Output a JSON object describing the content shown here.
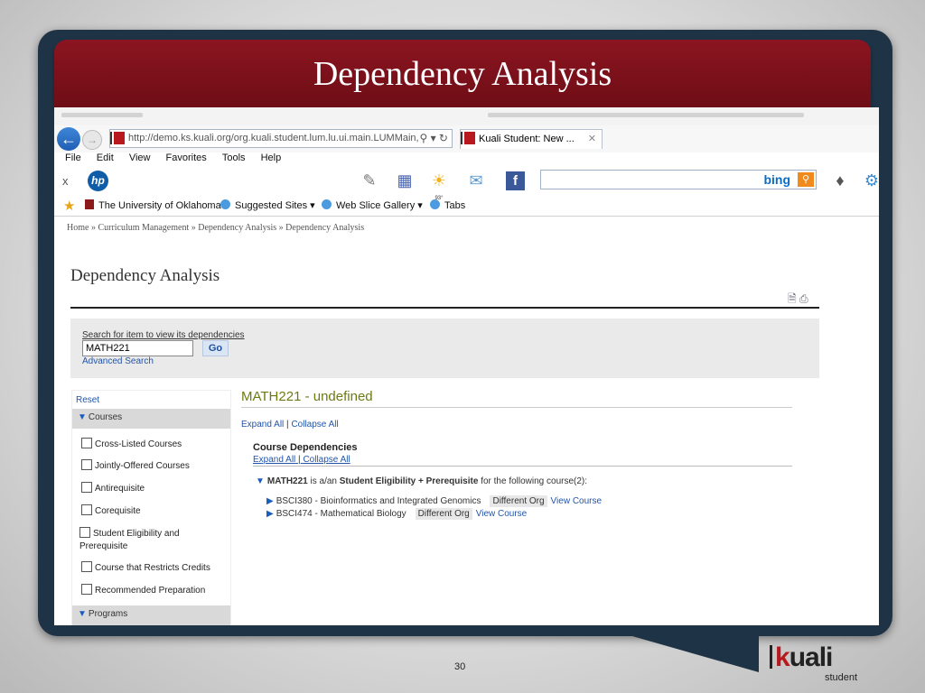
{
  "slide": {
    "title": "Dependency Analysis",
    "page_number": "30",
    "logo": {
      "mark": "kuali",
      "sub": "student"
    }
  },
  "browser": {
    "url": "http://demo.ks.kuali.org/org.kuali.student.lum.lu.ui.main.LUMMain,",
    "tab_title": "Kuali Student: New ...",
    "menu": [
      "File",
      "Edit",
      "View",
      "Favorites",
      "Tools",
      "Help"
    ],
    "search_engine": "bing",
    "favorites": [
      "The University of Oklahoma",
      "Suggested Sites ▾",
      "Web Slice Gallery ▾",
      "Tabs"
    ],
    "toolbar_icons": [
      "hp-icon",
      "news-icon",
      "traffic-icon",
      "weather-icon",
      "mail-icon",
      "facebook-icon",
      "games-icon"
    ],
    "weather_temp": "93°"
  },
  "page": {
    "breadcrumb": "Home » Curriculum Management » Dependency Analysis » Dependency Analysis",
    "title": "Dependency Analysis",
    "search": {
      "label": "Search for item to view its dependencies",
      "value": "MATH221",
      "go": "Go",
      "advanced": "Advanced Search"
    },
    "facets": {
      "reset": "Reset",
      "courses_header": "Courses",
      "items": [
        "Cross-Listed Courses",
        "Jointly-Offered Courses",
        "Antirequisite",
        "Corequisite",
        "Student Eligibility and Prerequisite",
        "Course that Restricts Credits",
        "Recommended Preparation"
      ],
      "programs_header": "Programs"
    },
    "result": {
      "title": "MATH221 - undefined",
      "expand_all": "Expand All",
      "collapse_all": "Collapse All",
      "section_title": "Course Dependencies",
      "dep_course": "MATH221",
      "dep_text1": "is a/an",
      "dep_relation": "Student Eligibility + Prerequisite",
      "dep_text2": "for the following course(2):",
      "courses": [
        {
          "name": "BSCI380 - Bioinformatics and Integrated Genomics",
          "org": "Different Org",
          "link": "View Course"
        },
        {
          "name": "BSCI474 - Mathematical Biology",
          "org": "Different Org",
          "link": "View Course"
        }
      ]
    }
  }
}
